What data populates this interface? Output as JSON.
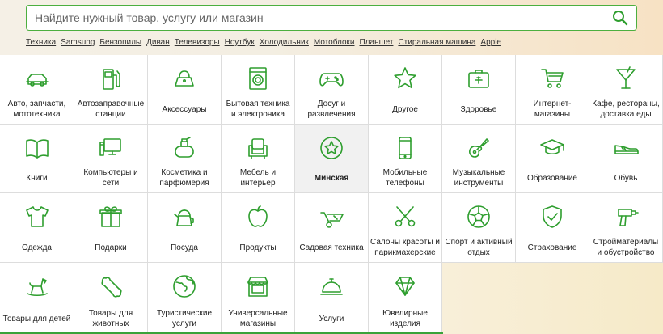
{
  "search": {
    "placeholder": "Найдите нужный товар, услугу или магазин"
  },
  "tags": [
    "Техника",
    "Samsung",
    "Бензопилы",
    "Диван",
    "Телевизоры",
    "Ноутбук",
    "Холодильник",
    "Мотоблоки",
    "Планшет",
    "Стиральная машина",
    "Apple"
  ],
  "categories": [
    {
      "label": "Авто, запчасти, мототехника",
      "icon": "car-icon"
    },
    {
      "label": "Автозаправочные станции",
      "icon": "fuel-pump-icon"
    },
    {
      "label": "Аксессуары",
      "icon": "bag-icon"
    },
    {
      "label": "Бытовая техника и электроника",
      "icon": "washing-machine-icon"
    },
    {
      "label": "Досуг и развлечения",
      "icon": "gamepad-icon"
    },
    {
      "label": "Другое",
      "icon": "star-icon"
    },
    {
      "label": "Здоровье",
      "icon": "first-aid-icon"
    },
    {
      "label": "Интернет-магазины",
      "icon": "cart-icon"
    },
    {
      "label": "Кафе, рестораны, доставка еды",
      "icon": "cocktail-icon"
    },
    {
      "label": "Книги",
      "icon": "book-icon"
    },
    {
      "label": "Компьютеры и сети",
      "icon": "computer-icon"
    },
    {
      "label": "Косметика и парфюмерия",
      "icon": "perfume-icon"
    },
    {
      "label": "Мебель и интерьер",
      "icon": "armchair-icon"
    },
    {
      "label": "Минская",
      "icon": "star-circle-icon"
    },
    {
      "label": "Мобильные телефоны",
      "icon": "phone-icon"
    },
    {
      "label": "Музыкальные инструменты",
      "icon": "guitar-icon"
    },
    {
      "label": "Образование",
      "icon": "graduation-cap-icon"
    },
    {
      "label": "Обувь",
      "icon": "shoe-icon"
    },
    {
      "label": "Одежда",
      "icon": "tshirt-icon"
    },
    {
      "label": "Подарки",
      "icon": "gift-icon"
    },
    {
      "label": "Посуда",
      "icon": "kettle-icon"
    },
    {
      "label": "Продукты",
      "icon": "apple-icon"
    },
    {
      "label": "Садовая техника",
      "icon": "wheelbarrow-icon"
    },
    {
      "label": "Салоны красоты и парикмахерские",
      "icon": "scissors-icon"
    },
    {
      "label": "Спорт и активный отдых",
      "icon": "soccer-ball-icon"
    },
    {
      "label": "Страхование",
      "icon": "shield-icon"
    },
    {
      "label": "Стройматериалы и обустройство",
      "icon": "drill-icon"
    },
    {
      "label": "Товары для детей",
      "icon": "rocking-horse-icon"
    },
    {
      "label": "Товары для животных",
      "icon": "bone-icon"
    },
    {
      "label": "Туристические услуги",
      "icon": "globe-icon"
    },
    {
      "label": "Универсальные магазины",
      "icon": "store-icon"
    },
    {
      "label": "Услуги",
      "icon": "service-bell-icon"
    },
    {
      "label": "Ювелирные изделия",
      "icon": "diamond-icon"
    }
  ],
  "active_category": "Минская",
  "colors": {
    "accent": "#2e9e2e",
    "border": "#4caf3f"
  }
}
